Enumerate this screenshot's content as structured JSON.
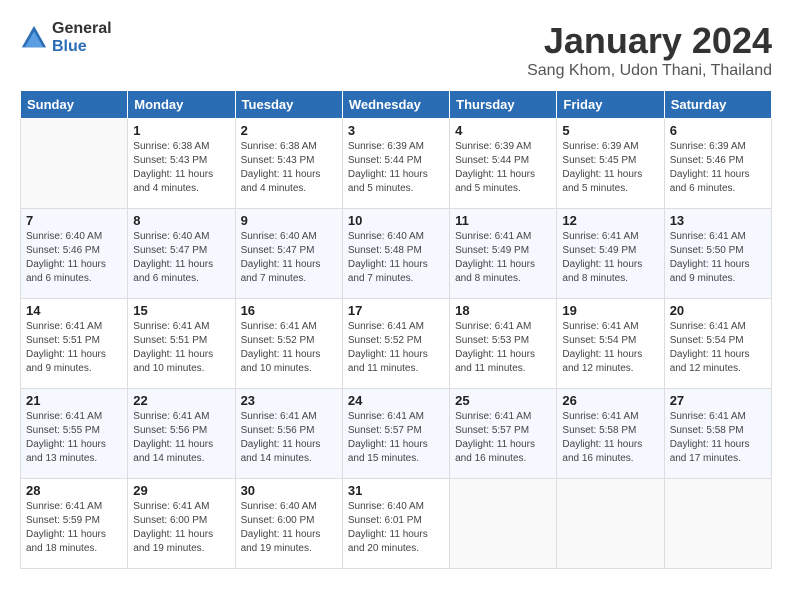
{
  "logo": {
    "general": "General",
    "blue": "Blue"
  },
  "title": "January 2024",
  "subtitle": "Sang Khom, Udon Thani, Thailand",
  "weekdays": [
    "Sunday",
    "Monday",
    "Tuesday",
    "Wednesday",
    "Thursday",
    "Friday",
    "Saturday"
  ],
  "weeks": [
    [
      {
        "num": "",
        "info": ""
      },
      {
        "num": "1",
        "info": "Sunrise: 6:38 AM\nSunset: 5:43 PM\nDaylight: 11 hours\nand 4 minutes."
      },
      {
        "num": "2",
        "info": "Sunrise: 6:38 AM\nSunset: 5:43 PM\nDaylight: 11 hours\nand 4 minutes."
      },
      {
        "num": "3",
        "info": "Sunrise: 6:39 AM\nSunset: 5:44 PM\nDaylight: 11 hours\nand 5 minutes."
      },
      {
        "num": "4",
        "info": "Sunrise: 6:39 AM\nSunset: 5:44 PM\nDaylight: 11 hours\nand 5 minutes."
      },
      {
        "num": "5",
        "info": "Sunrise: 6:39 AM\nSunset: 5:45 PM\nDaylight: 11 hours\nand 5 minutes."
      },
      {
        "num": "6",
        "info": "Sunrise: 6:39 AM\nSunset: 5:46 PM\nDaylight: 11 hours\nand 6 minutes."
      }
    ],
    [
      {
        "num": "7",
        "info": "Sunrise: 6:40 AM\nSunset: 5:46 PM\nDaylight: 11 hours\nand 6 minutes."
      },
      {
        "num": "8",
        "info": "Sunrise: 6:40 AM\nSunset: 5:47 PM\nDaylight: 11 hours\nand 6 minutes."
      },
      {
        "num": "9",
        "info": "Sunrise: 6:40 AM\nSunset: 5:47 PM\nDaylight: 11 hours\nand 7 minutes."
      },
      {
        "num": "10",
        "info": "Sunrise: 6:40 AM\nSunset: 5:48 PM\nDaylight: 11 hours\nand 7 minutes."
      },
      {
        "num": "11",
        "info": "Sunrise: 6:41 AM\nSunset: 5:49 PM\nDaylight: 11 hours\nand 8 minutes."
      },
      {
        "num": "12",
        "info": "Sunrise: 6:41 AM\nSunset: 5:49 PM\nDaylight: 11 hours\nand 8 minutes."
      },
      {
        "num": "13",
        "info": "Sunrise: 6:41 AM\nSunset: 5:50 PM\nDaylight: 11 hours\nand 9 minutes."
      }
    ],
    [
      {
        "num": "14",
        "info": "Sunrise: 6:41 AM\nSunset: 5:51 PM\nDaylight: 11 hours\nand 9 minutes."
      },
      {
        "num": "15",
        "info": "Sunrise: 6:41 AM\nSunset: 5:51 PM\nDaylight: 11 hours\nand 10 minutes."
      },
      {
        "num": "16",
        "info": "Sunrise: 6:41 AM\nSunset: 5:52 PM\nDaylight: 11 hours\nand 10 minutes."
      },
      {
        "num": "17",
        "info": "Sunrise: 6:41 AM\nSunset: 5:52 PM\nDaylight: 11 hours\nand 11 minutes."
      },
      {
        "num": "18",
        "info": "Sunrise: 6:41 AM\nSunset: 5:53 PM\nDaylight: 11 hours\nand 11 minutes."
      },
      {
        "num": "19",
        "info": "Sunrise: 6:41 AM\nSunset: 5:54 PM\nDaylight: 11 hours\nand 12 minutes."
      },
      {
        "num": "20",
        "info": "Sunrise: 6:41 AM\nSunset: 5:54 PM\nDaylight: 11 hours\nand 12 minutes."
      }
    ],
    [
      {
        "num": "21",
        "info": "Sunrise: 6:41 AM\nSunset: 5:55 PM\nDaylight: 11 hours\nand 13 minutes."
      },
      {
        "num": "22",
        "info": "Sunrise: 6:41 AM\nSunset: 5:56 PM\nDaylight: 11 hours\nand 14 minutes."
      },
      {
        "num": "23",
        "info": "Sunrise: 6:41 AM\nSunset: 5:56 PM\nDaylight: 11 hours\nand 14 minutes."
      },
      {
        "num": "24",
        "info": "Sunrise: 6:41 AM\nSunset: 5:57 PM\nDaylight: 11 hours\nand 15 minutes."
      },
      {
        "num": "25",
        "info": "Sunrise: 6:41 AM\nSunset: 5:57 PM\nDaylight: 11 hours\nand 16 minutes."
      },
      {
        "num": "26",
        "info": "Sunrise: 6:41 AM\nSunset: 5:58 PM\nDaylight: 11 hours\nand 16 minutes."
      },
      {
        "num": "27",
        "info": "Sunrise: 6:41 AM\nSunset: 5:58 PM\nDaylight: 11 hours\nand 17 minutes."
      }
    ],
    [
      {
        "num": "28",
        "info": "Sunrise: 6:41 AM\nSunset: 5:59 PM\nDaylight: 11 hours\nand 18 minutes."
      },
      {
        "num": "29",
        "info": "Sunrise: 6:41 AM\nSunset: 6:00 PM\nDaylight: 11 hours\nand 19 minutes."
      },
      {
        "num": "30",
        "info": "Sunrise: 6:40 AM\nSunset: 6:00 PM\nDaylight: 11 hours\nand 19 minutes."
      },
      {
        "num": "31",
        "info": "Sunrise: 6:40 AM\nSunset: 6:01 PM\nDaylight: 11 hours\nand 20 minutes."
      },
      {
        "num": "",
        "info": ""
      },
      {
        "num": "",
        "info": ""
      },
      {
        "num": "",
        "info": ""
      }
    ]
  ]
}
